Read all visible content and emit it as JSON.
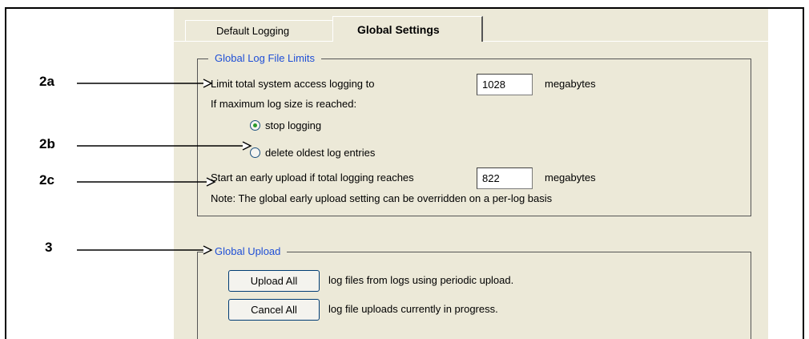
{
  "tabs": [
    {
      "label": "Default Logging",
      "active": false
    },
    {
      "label": "Global Settings",
      "active": true
    }
  ],
  "limits": {
    "group_title": "Global Log File Limits",
    "limit_label": "Limit total system access logging to",
    "limit_value": "1028",
    "limit_unit": "megabytes",
    "max_reached_label": "If maximum log size is reached:",
    "options": [
      {
        "label": "stop logging",
        "selected": true
      },
      {
        "label": "delete oldest log entries",
        "selected": false
      }
    ],
    "early_label": "Start an early upload if total logging reaches",
    "early_value": "822",
    "early_unit": "megabytes",
    "note": "Note: The global early upload setting can be overridden on a per-log basis"
  },
  "upload": {
    "group_title": "Global Upload",
    "upload_all_button": "Upload All",
    "upload_all_desc": "log files from logs using periodic upload.",
    "cancel_all_button": "Cancel All",
    "cancel_all_desc": "log file uploads currently in progress."
  },
  "callouts": [
    "2a",
    "2b",
    "2c",
    "3"
  ],
  "colors": {
    "panel_bg": "#ece9d8",
    "group_title": "#1f4fd6",
    "radio_selected": "#2a9a2a"
  }
}
